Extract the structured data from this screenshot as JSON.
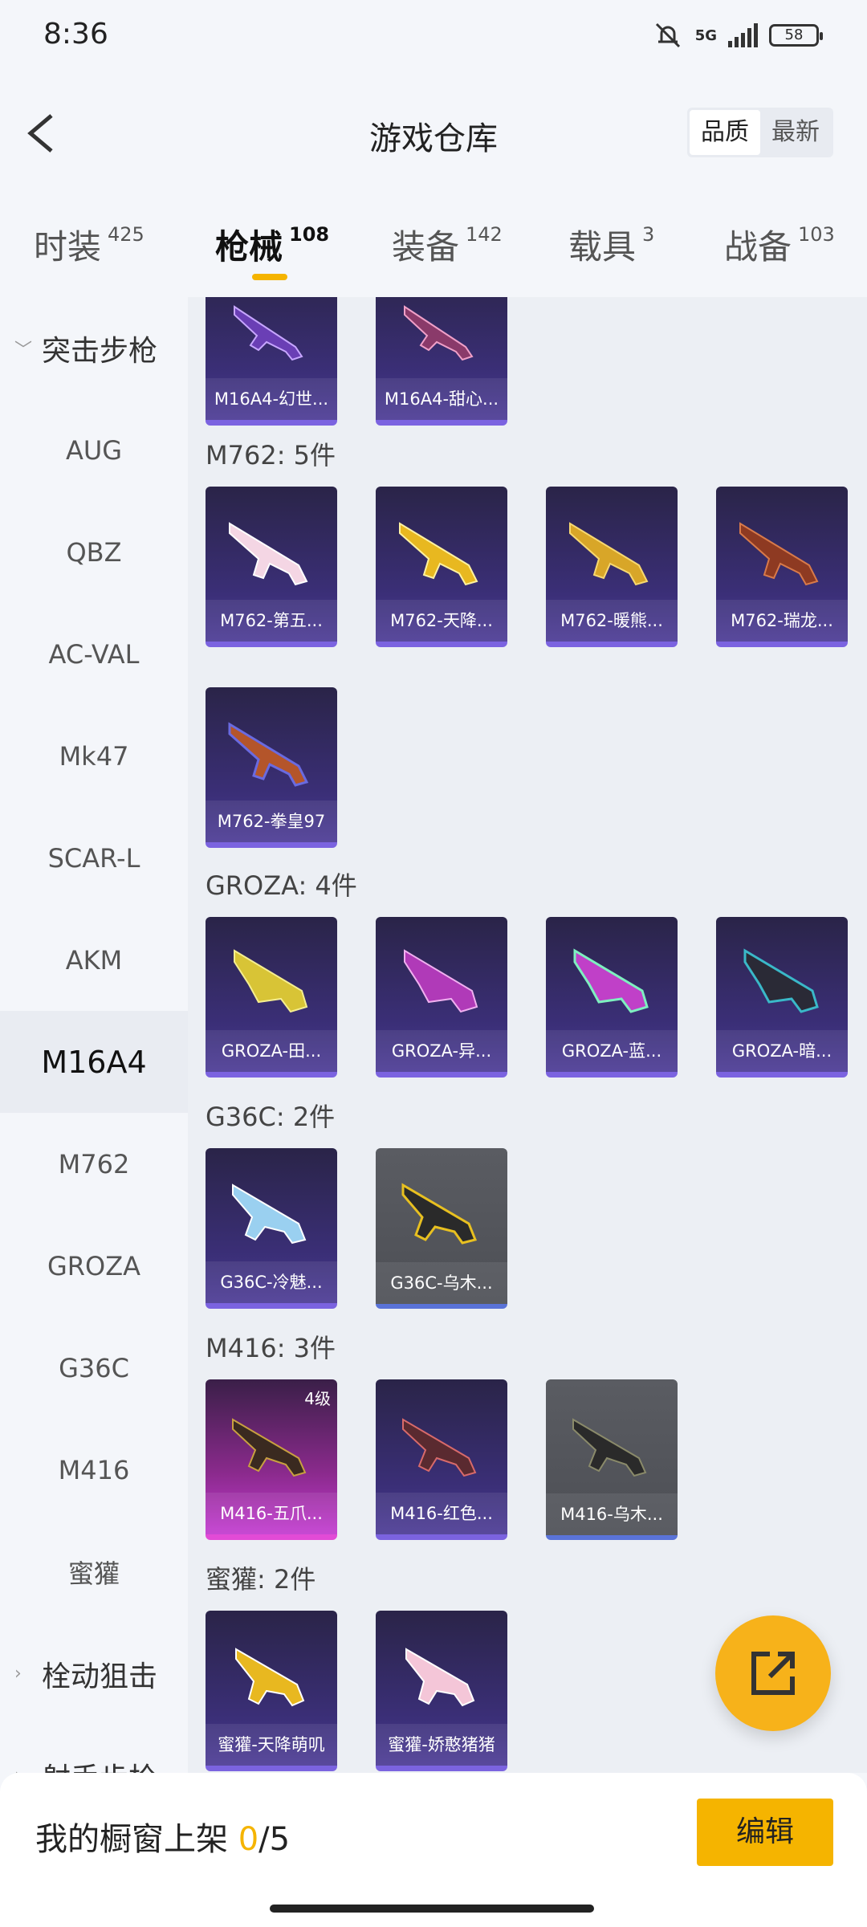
{
  "status": {
    "time": "8:36",
    "network": "5G",
    "battery": "58"
  },
  "header": {
    "title": "游戏仓库",
    "sort_quality": "品质",
    "sort_latest": "最新"
  },
  "tabs": [
    {
      "label": "时装",
      "count": "425"
    },
    {
      "label": "枪械",
      "count": "108"
    },
    {
      "label": "装备",
      "count": "142"
    },
    {
      "label": "载具",
      "count": "3"
    },
    {
      "label": "战备",
      "count": "103"
    }
  ],
  "sidebar": {
    "group_assault": "突击步枪",
    "items": [
      "AUG",
      "QBZ",
      "AC-VAL",
      "Mk47",
      "SCAR-L",
      "AKM",
      "M16A4",
      "M762",
      "GROZA",
      "G36C",
      "M416",
      "蜜獾"
    ],
    "group_bolt": "栓动狙击",
    "group_dmr": "射手步枪"
  },
  "sections": {
    "m16a4": {
      "cards": [
        "M16A4-幻世...",
        "M16A4-甜心..."
      ]
    },
    "m762": {
      "title": "M762: 5件",
      "cards": [
        "M762-第五...",
        "M762-天降...",
        "M762-暖熊...",
        "M762-瑞龙...",
        "M762-拳皇97"
      ]
    },
    "groza": {
      "title": "GROZA: 4件",
      "cards": [
        "GROZA-田...",
        "GROZA-异...",
        "GROZA-蓝...",
        "GROZA-暗..."
      ]
    },
    "g36c": {
      "title": "G36C: 2件",
      "cards": [
        "G36C-冷魅...",
        "G36C-乌木..."
      ]
    },
    "m416": {
      "title": "M416: 3件",
      "cards": [
        "M416-五爪...",
        "M416-红色...",
        "M416-乌木..."
      ],
      "level_badge": "4级"
    },
    "honeybadger": {
      "title": "蜜獾: 2件",
      "cards": [
        "蜜獾-天降萌叽",
        "蜜獾-娇憨猪猪"
      ]
    }
  },
  "bottom": {
    "shelf_label": "我的橱窗上架",
    "shelf_count": "0",
    "shelf_total": "/5",
    "edit_label": "编辑"
  },
  "colors": {
    "accent": "#f5b400",
    "card_purple": "#3b2f78",
    "card_gray": "#55575d",
    "card_pink": "#c23ad0"
  }
}
